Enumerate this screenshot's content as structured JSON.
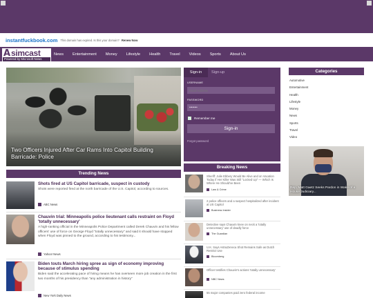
{
  "domain_strip": {
    "domain": "instantfuckbook.com",
    "note": "This domain has expired. Is this your domain?",
    "renew": "Renew Now"
  },
  "brand": {
    "logo_letter": "A",
    "logo_name": "simcast",
    "logo_sub": "Powered by Microsoft News"
  },
  "nav": {
    "items": [
      "News",
      "Entertainment",
      "Money",
      "Lifestyle",
      "Health",
      "Travel",
      "Videos",
      "Sports",
      "About Us"
    ]
  },
  "hero": {
    "caption": "Two Officers Injured After Car Rams Into Capitol Building Barricade: Police"
  },
  "signin": {
    "tab_signin": "Sign-in",
    "tab_signup": "Sign-up",
    "username_label": "USERNAME",
    "username_placeholder": "Email Address",
    "password_label": "PASSWORD",
    "password_value": "••••••••",
    "remember_label": "Remember me",
    "remember_checked": true,
    "button": "Sign-in",
    "forgot": "Forgot password"
  },
  "categories": {
    "title": "Categories",
    "items": [
      "Automotive",
      "Entertainment",
      "Health",
      "Lifestyle",
      "Money",
      "News",
      "Sports",
      "Travel",
      "Video"
    ]
  },
  "right_ad": {
    "caption": "Rep. Matt Gaetz Seeks Pardon in Wake of a House Judiciary..."
  },
  "trending": {
    "title": "Trending News",
    "items": [
      {
        "title": "Shots fired at US Capitol barricade, suspect in custody",
        "body": "Shots were reported fired at the north barricade of the U.S. Capitol, according to sources.",
        "source": "ABC News"
      },
      {
        "title": "Chauvin trial: Minneapolis police lieutenant calls restraint on Floyd 'totally unnecessary'",
        "body": "A high-ranking official in the Minneapolis Police Department called Derek Chauvin and his fellow officers' use of force on George Floyd \"totally unnecessary\" and said it should have stopped when Floyd was pinned to the ground, according to his testimony...",
        "source": "Yahoo! News"
      },
      {
        "title": "Biden touts March hiring spree as sign of economy improving because of stimulus spending",
        "body": "Biden said the accelerating pace of hiring means he has overseen more job creation in the first two months of his presidency than \"any administration in history\"",
        "source": "New York Daily News"
      }
    ]
  },
  "breaking": {
    "title": "Breaking News",
    "items": [
      {
        "text": "Sheriff: Julie Ebbery Would Be Alive and on Vacation Today if Her Killer Was Still \"Locked Up\" — Which Is Where He Should've Been",
        "source": "Law & Crime"
      },
      {
        "text": "2 police officers and a suspect hospitalized after incident at US Capitol",
        "source": "Business Insider"
      },
      {
        "text": "Detective says Chauvin knee on neck a 'totally unnecessary' use of deadly force",
        "source": "The Guardian"
      },
      {
        "text": "U.K. Says AstraZeneca Shot Remains Safe as Dutch Restrict Use",
        "source": "Bloomberg"
      },
      {
        "text": "Officer testifies Chauvin's actions 'totally unnecessary'",
        "source": "NBC News"
      },
      {
        "text": "55 major companies paid zero federal income",
        "source": ""
      }
    ]
  }
}
